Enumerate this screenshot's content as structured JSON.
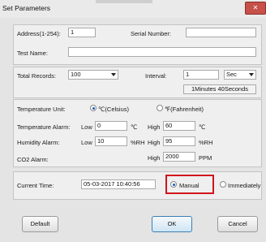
{
  "window": {
    "title": "Set Parameters",
    "close_glyph": "✕"
  },
  "device": {
    "address_label": "Address(1-254):",
    "address_value": "1",
    "serial_label": "Serial Number:",
    "serial_value": "",
    "testname_label": "Test Name:",
    "testname_value": ""
  },
  "records": {
    "total_label": "Total Records:",
    "total_value": "100",
    "interval_label": "Interval:",
    "interval_value": "1",
    "interval_unit": "Sec",
    "interval_summary": "1Minutes 40Seconds"
  },
  "temperature": {
    "unit_label": "Temperature Unit:",
    "celsius_label": "℃(Celsius)",
    "fahrenheit_label": "℉(Fahrenheit)",
    "selected_unit": "celsius",
    "alarm_label": "Temperature Alarm:",
    "low_label": "Low",
    "low_value": "0",
    "low_unit": "℃",
    "high_label": "High",
    "high_value": "60",
    "high_unit": "℃"
  },
  "humidity": {
    "alarm_label": "Humidity Alarm:",
    "low_label": "Low",
    "low_value": "10",
    "low_unit": "%RH",
    "high_label": "High",
    "high_value": "95",
    "high_unit": "%RH"
  },
  "co2": {
    "alarm_label": "CO2 Alarm:",
    "high_label": "High",
    "high_value": "2000",
    "high_unit": "PPM"
  },
  "time": {
    "label": "Current Time:",
    "value": "05-03-2017 10:40:56",
    "manual_label": "Manual",
    "immediately_label": "Immediately",
    "selected": "manual",
    "highlight_color": "#d0141b"
  },
  "buttons": {
    "default": "Default",
    "ok": "OK",
    "cancel": "Cancel"
  }
}
